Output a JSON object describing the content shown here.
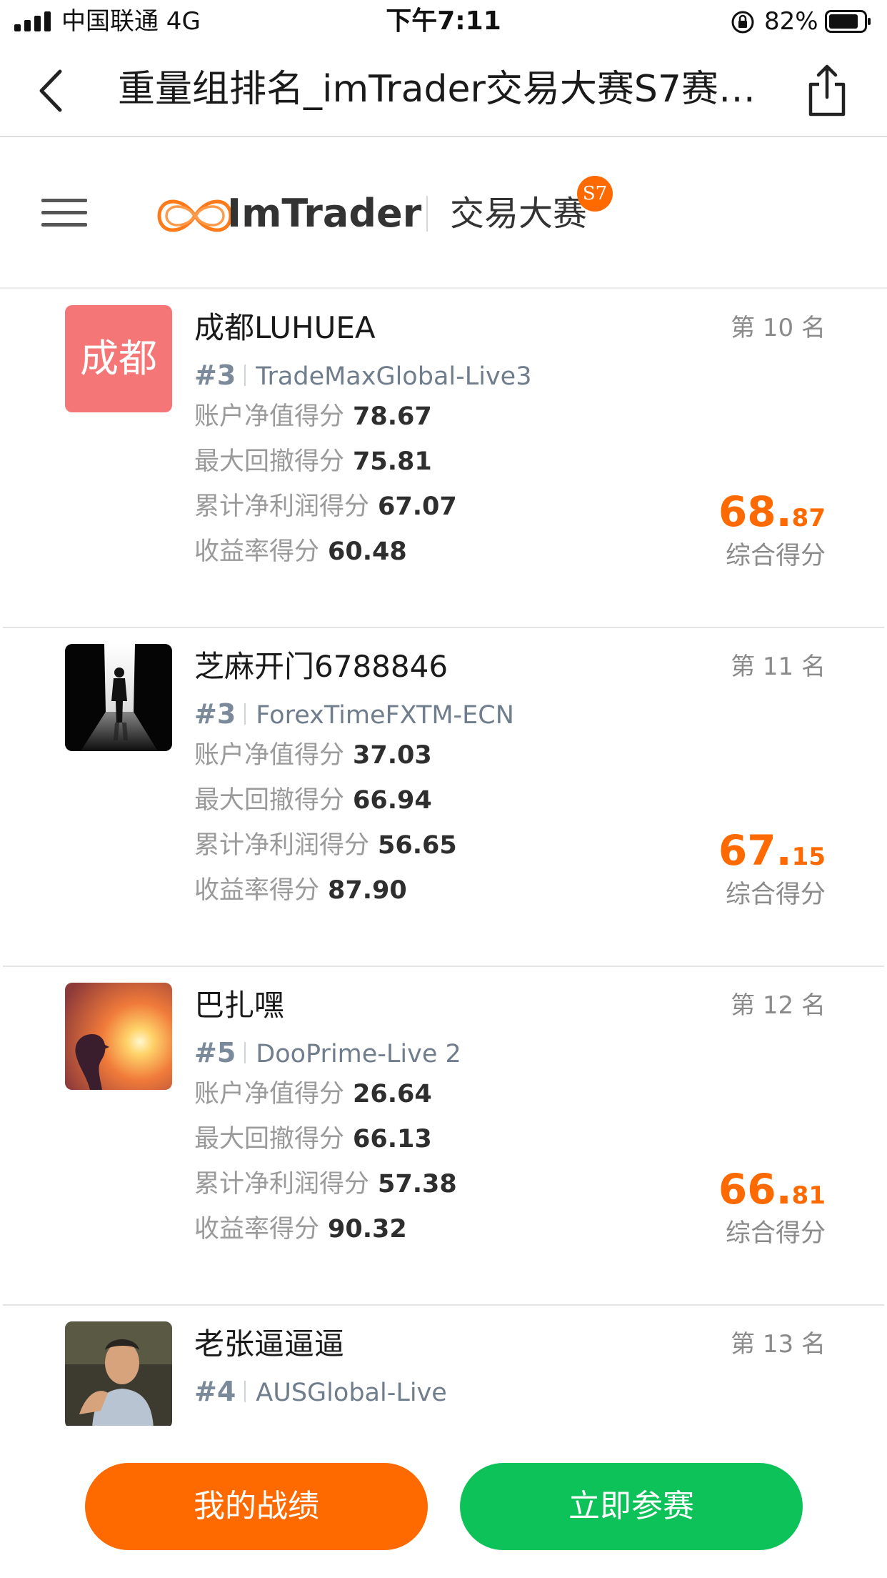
{
  "status_bar": {
    "carrier": "中国联通  4G",
    "time": "下午7:11",
    "battery": "82%"
  },
  "nav": {
    "title": "重量组排名_imTrader交易大赛S7赛…",
    "back_icon": "chevron-left-icon",
    "share_icon": "share-icon"
  },
  "header": {
    "brand": "ImTrader",
    "subtitle": "交易大赛",
    "season": "S7",
    "menu_icon": "menu-icon",
    "brand_color": "#ff6a00"
  },
  "traders": [
    {
      "name": "成都LUHUEA",
      "avatar_text": "成都",
      "rank": "第 10 名",
      "server_num": "#3",
      "server": "TradeMaxGlobal-Live3",
      "scores": [
        {
          "label": "账户净值得分",
          "value": "78.67"
        },
        {
          "label": "最大回撤得分",
          "value": "75.81"
        },
        {
          "label": "累计净利润得分",
          "value": "67.07"
        },
        {
          "label": "收益率得分",
          "value": "60.48"
        }
      ],
      "total_int": "68.",
      "total_dec": "87",
      "total_label": "综合得分"
    },
    {
      "name": "芝麻开门6788846",
      "avatar_text": "",
      "rank": "第 11 名",
      "server_num": "#3",
      "server": "ForexTimeFXTM-ECN",
      "scores": [
        {
          "label": "账户净值得分",
          "value": "37.03"
        },
        {
          "label": "最大回撤得分",
          "value": "66.94"
        },
        {
          "label": "累计净利润得分",
          "value": "56.65"
        },
        {
          "label": "收益率得分",
          "value": "87.90"
        }
      ],
      "total_int": "67.",
      "total_dec": "15",
      "total_label": "综合得分"
    },
    {
      "name": "巴扎嘿",
      "avatar_text": "",
      "rank": "第 12 名",
      "server_num": "#5",
      "server": "DooPrime-Live 2",
      "scores": [
        {
          "label": "账户净值得分",
          "value": "26.64"
        },
        {
          "label": "最大回撤得分",
          "value": "66.13"
        },
        {
          "label": "累计净利润得分",
          "value": "57.38"
        },
        {
          "label": "收益率得分",
          "value": "90.32"
        }
      ],
      "total_int": "66.",
      "total_dec": "81",
      "total_label": "综合得分"
    },
    {
      "name": "老张逼逼逼",
      "avatar_text": "",
      "rank": "第 13 名",
      "server_num": "#4",
      "server": "AUSGlobal-Live",
      "scores": [],
      "total_int": "",
      "total_dec": "",
      "total_label": ""
    }
  ],
  "bottom": {
    "my_records": "我的战绩",
    "join_now": "立即参赛"
  }
}
